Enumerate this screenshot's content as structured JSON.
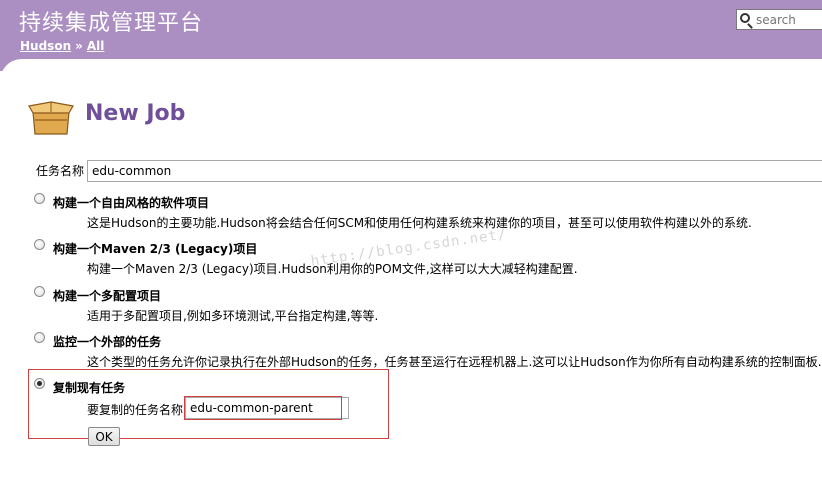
{
  "header": {
    "site_title": "持续集成管理平台",
    "breadcrumb": [
      "Hudson",
      "All"
    ],
    "breadcrumb_separator": "»",
    "search_placeholder": "search"
  },
  "page": {
    "title": "New Job",
    "job_name_label": "任务名称",
    "job_name_value": "edu-common"
  },
  "options": [
    {
      "title": "构建一个自由风格的软件项目",
      "description": "这是Hudson的主要功能.Hudson将会结合任何SCM和使用任何构建系统来构建你的项目，甚至可以使用软件构建以外的系统.",
      "selected": false
    },
    {
      "title": "构建一个Maven 2/3 (Legacy)项目",
      "description": "构建一个Maven 2/3 (Legacy)项目.Hudson利用你的POM文件,这样可以大大减轻构建配置.",
      "selected": false
    },
    {
      "title": "构建一个多配置项目",
      "description": "适用于多配置项目,例如多环境测试,平台指定构建,等等.",
      "selected": false
    },
    {
      "title": "监控一个外部的任务",
      "description": "这个类型的任务允许你记录执行在外部Hudson的任务，任务甚至运行在远程机器上.这可以让Hudson作为你所有自动构建系统的控制面板.参",
      "selected": false
    },
    {
      "title": "复制现有任务",
      "selected": true
    }
  ],
  "copy": {
    "label": "要复制的任务名称",
    "value": "edu-common-parent"
  },
  "ok_label": "OK",
  "watermark": "http://blog.csdn.net/",
  "colors": {
    "header_bg": "#ac8fc2",
    "title_purple": "#6f4f9a",
    "highlight_red": "#d04040"
  }
}
